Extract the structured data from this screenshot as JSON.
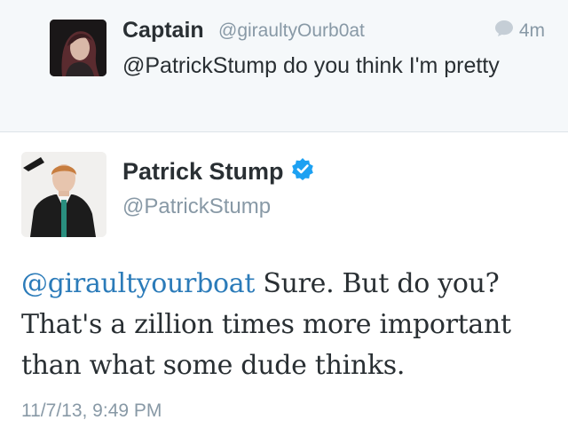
{
  "reply": {
    "name": "Captain",
    "handle": "@giraultyOurb0at",
    "time": "4m",
    "text": "@PatrickStump do you think I'm pretty",
    "reply_icon": "speech-bubble-icon"
  },
  "tweet": {
    "name": "Patrick Stump",
    "handle": "@PatrickStump",
    "verified_icon": "verified-badge-icon",
    "mention": "@giraultyourboat",
    "text": " Sure. But do you? That's a zillion times more important than what some dude thinks.",
    "timestamp": "11/7/13, 9:49 PM"
  },
  "colors": {
    "link": "#2b7bb9",
    "muted": "#8899a6",
    "verified": "#1da1f2",
    "panel_bg": "#f5f8fa"
  }
}
